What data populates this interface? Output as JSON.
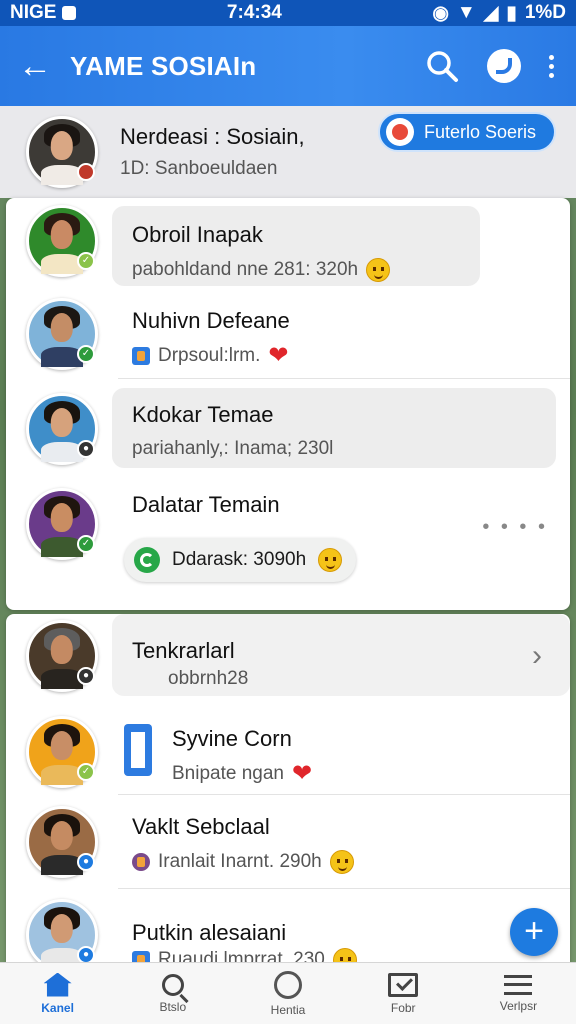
{
  "status_bar": {
    "carrier": "NIGE",
    "time": "7:4:34",
    "battery": "1%D"
  },
  "app_bar": {
    "title": "YAME SOSIAIn",
    "back_icon": "back-arrow-icon",
    "search_icon": "search-icon",
    "action_icon": "chat-bubble-icon",
    "menu_icon": "more-vert-icon"
  },
  "profile": {
    "name": "Nerdeasi : Sosiain,",
    "sub": "1D: Sanboeuldaen",
    "button_label": "Futerlo Soeris"
  },
  "chats_top": [
    {
      "name": "Obroil Inapak",
      "sub": "pabohldand nne 281: 320h",
      "status_color": "#8bc34a"
    },
    {
      "name": "Nuhivn Defeane",
      "sub": "Drpsoul:lrm.",
      "status_color": "#2e9b3c"
    },
    {
      "name": "Kdokar Temae",
      "sub": "pariahanly,: Inama; 230l",
      "status_color": "#333333"
    },
    {
      "name": "Dalatar Temain",
      "sub": "Ddarask: 3090h",
      "status_color": "#2e9b3c"
    }
  ],
  "chats_bottom": [
    {
      "name": "Tenkrarlarl",
      "sub": "obbrnh28",
      "status_color": "#333333"
    },
    {
      "name": "Syvine Corn",
      "sub": "Bnipate ngan",
      "status_color": "#8bc34a"
    },
    {
      "name": "Vaklt Sebclaal",
      "sub": "Iranlait Inarnt. 290h",
      "status_color": "#1e7be0"
    },
    {
      "name": "Putkin alesaiani",
      "sub": "Ruaudi lmprrat. 230",
      "status_color": "#1e7be0"
    }
  ],
  "bottom_nav": [
    {
      "label": "Kanel",
      "icon": "home-icon"
    },
    {
      "label": "Btslo",
      "icon": "search-icon"
    },
    {
      "label": "Hentia",
      "icon": "badge-icon"
    },
    {
      "label": "Fobr",
      "icon": "mail-icon"
    },
    {
      "label": "Verlpsr",
      "icon": "menu-icon"
    }
  ],
  "colors": {
    "accent": "#2a7ae4",
    "status_bar": "#0f55b8",
    "heart": "#e0262b"
  }
}
